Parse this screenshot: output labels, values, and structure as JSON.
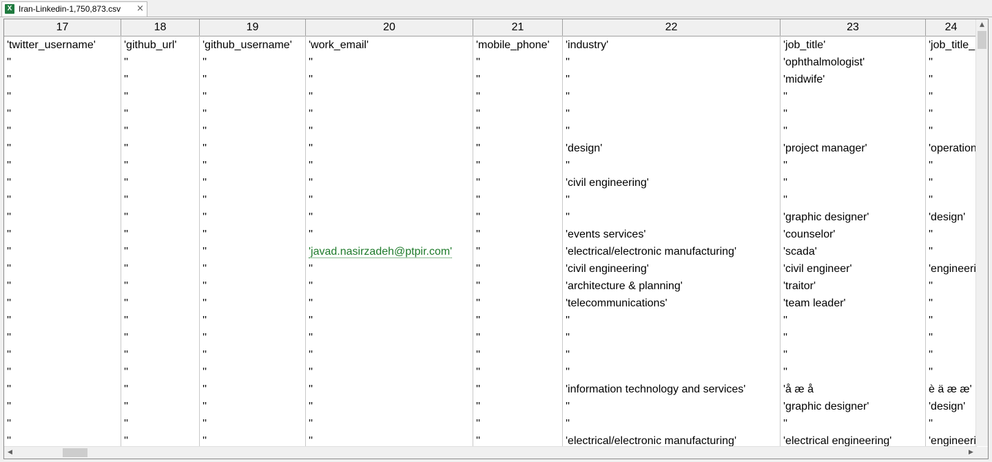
{
  "tab": {
    "title": "Iran-Linkedin-1,750,873.csv",
    "close": "×",
    "icon": "excel-file-icon",
    "icon_glyph": "X"
  },
  "columns": [
    "17",
    "18",
    "19",
    "20",
    "21",
    "22",
    "23",
    "24"
  ],
  "rows": [
    [
      "'twitter_username'",
      "'github_url'",
      "'github_username'",
      "'work_email'",
      "'mobile_phone'",
      "'industry'",
      "'job_title'",
      "'job_title_role'"
    ],
    [
      "''",
      "''",
      "''",
      "''",
      "''",
      "''",
      "'ophthalmologist'",
      "''"
    ],
    [
      "''",
      "''",
      "''",
      "''",
      "''",
      "''",
      "'midwife'",
      "''"
    ],
    [
      "''",
      "''",
      "''",
      "''",
      "''",
      "''",
      "''",
      "''"
    ],
    [
      "''",
      "''",
      "''",
      "''",
      "''",
      "''",
      "''",
      "''"
    ],
    [
      "''",
      "''",
      "''",
      "''",
      "''",
      "''",
      "''",
      "''"
    ],
    [
      "''",
      "''",
      "''",
      "''",
      "''",
      "'design'",
      "'project manager'",
      "'operations'"
    ],
    [
      "''",
      "''",
      "''",
      "''",
      "''",
      "''",
      "''",
      "''"
    ],
    [
      "''",
      "''",
      "''",
      "''",
      "''",
      "'civil engineering'",
      "''",
      "''"
    ],
    [
      "''",
      "''",
      "''",
      "''",
      "''",
      "''",
      "''",
      "''"
    ],
    [
      "''",
      "''",
      "''",
      "''",
      "''",
      "''",
      "'graphic designer'",
      "'design'"
    ],
    [
      "''",
      "''",
      "''",
      "''",
      "''",
      "'events services'",
      "'counselor'",
      "''"
    ],
    [
      "''",
      "''",
      "''",
      "'javad.nasirzadeh@ptpir.com'",
      "''",
      "'electrical/electronic manufacturing'",
      "'scada'",
      "''"
    ],
    [
      "''",
      "''",
      "''",
      "''",
      "''",
      "'civil engineering'",
      "'civil engineer'",
      "'engineering'"
    ],
    [
      "''",
      "''",
      "''",
      "''",
      "''",
      "'architecture & planning'",
      "'traitor'",
      "''"
    ],
    [
      "''",
      "''",
      "''",
      "''",
      "''",
      "'telecommunications'",
      "'team leader'",
      "''"
    ],
    [
      "''",
      "''",
      "''",
      "''",
      "''",
      "''",
      "''",
      "''"
    ],
    [
      "''",
      "''",
      "''",
      "''",
      "''",
      "''",
      "''",
      "''"
    ],
    [
      "''",
      "''",
      "''",
      "''",
      "''",
      "''",
      "''",
      "''"
    ],
    [
      "''",
      "''",
      "''",
      "''",
      "''",
      "''",
      "''",
      "''"
    ],
    [
      "''",
      "''",
      "''",
      "''",
      "''",
      "'information technology and services'",
      "'å æ å",
      "è ä æ æ'"
    ],
    [
      "''",
      "''",
      "''",
      "''",
      "''",
      "''",
      "'graphic designer'",
      "'design'"
    ],
    [
      "''",
      "''",
      "''",
      "''",
      "''",
      "''",
      "''",
      "''"
    ],
    [
      "''",
      "''",
      "''",
      "''",
      "''",
      "'electrical/electronic manufacturing'",
      "'electrical engineering'",
      "'engineering'"
    ]
  ],
  "scroll": {
    "up": "▲",
    "left": "◀",
    "right": "▶"
  }
}
